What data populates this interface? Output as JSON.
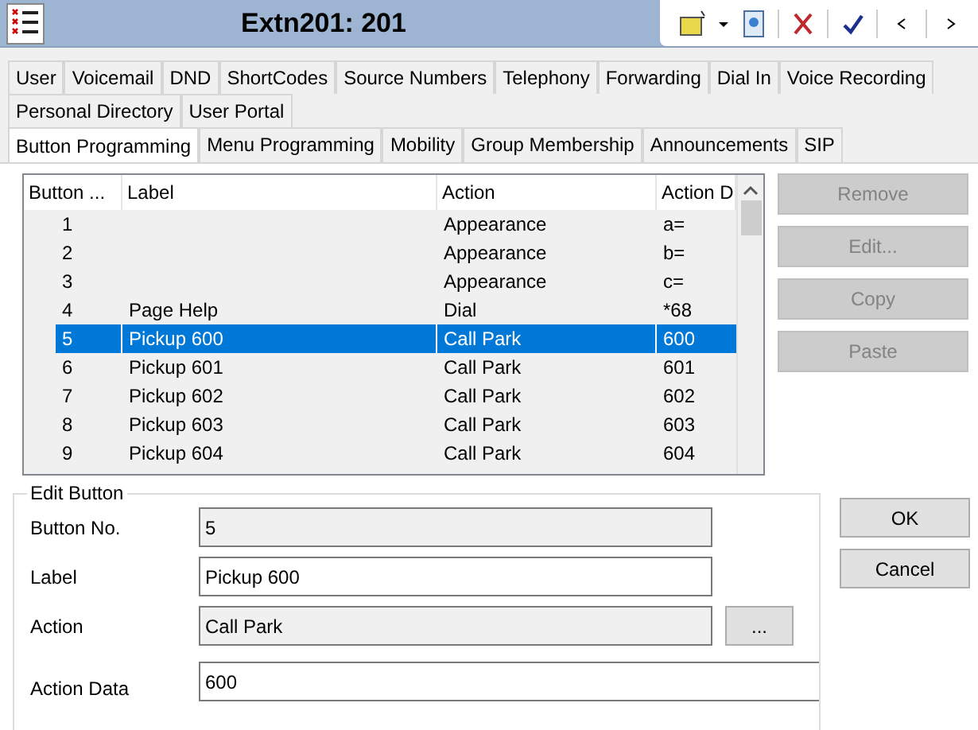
{
  "window": {
    "title": "Extn201: 201"
  },
  "tab_rows": [
    [
      {
        "label": "User",
        "selected": false
      },
      {
        "label": "Voicemail",
        "selected": false
      },
      {
        "label": "DND",
        "selected": false
      },
      {
        "label": "ShortCodes",
        "selected": false
      },
      {
        "label": "Source Numbers",
        "selected": false
      },
      {
        "label": "Telephony",
        "selected": false
      },
      {
        "label": "Forwarding",
        "selected": false
      },
      {
        "label": "Dial In",
        "selected": false
      },
      {
        "label": "Voice Recording",
        "selected": false
      }
    ],
    [
      {
        "label": "Personal Directory",
        "selected": false
      },
      {
        "label": "User Portal",
        "selected": false
      }
    ],
    [
      {
        "label": "Button Programming",
        "selected": true
      },
      {
        "label": "Menu Programming",
        "selected": false
      },
      {
        "label": "Mobility",
        "selected": false
      },
      {
        "label": "Group Membership",
        "selected": false
      },
      {
        "label": "Announcements",
        "selected": false
      },
      {
        "label": "SIP",
        "selected": false
      }
    ]
  ],
  "table": {
    "columns": [
      "Button ...",
      "Label",
      "Action",
      "Action D"
    ],
    "rows": [
      {
        "cells": [
          "1",
          "",
          "Appearance",
          "a="
        ],
        "selected": false
      },
      {
        "cells": [
          "2",
          "",
          "Appearance",
          "b="
        ],
        "selected": false
      },
      {
        "cells": [
          "3",
          "",
          "Appearance",
          "c="
        ],
        "selected": false
      },
      {
        "cells": [
          "4",
          "Page Help",
          "Dial",
          "*68"
        ],
        "selected": false
      },
      {
        "cells": [
          "5",
          "Pickup 600",
          "Call Park",
          "600"
        ],
        "selected": true
      },
      {
        "cells": [
          "6",
          "Pickup 601",
          "Call Park",
          "601"
        ],
        "selected": false
      },
      {
        "cells": [
          "7",
          "Pickup 602",
          "Call Park",
          "602"
        ],
        "selected": false
      },
      {
        "cells": [
          "8",
          "Pickup 603",
          "Call Park",
          "603"
        ],
        "selected": false
      },
      {
        "cells": [
          "9",
          "Pickup 604",
          "Call Park",
          "604"
        ],
        "selected": false
      }
    ]
  },
  "list_buttons": [
    {
      "label": "Remove",
      "disabled": true
    },
    {
      "label": "Edit...",
      "disabled": true
    },
    {
      "label": "Copy",
      "disabled": true
    },
    {
      "label": "Paste",
      "disabled": true
    }
  ],
  "edit_button": {
    "title": "Edit Button",
    "fields": [
      {
        "label": "Button No.",
        "value": "5",
        "readonly": true
      },
      {
        "label": "Label",
        "value": "Pickup 600",
        "readonly": false
      },
      {
        "label": "Action",
        "value": "Call Park",
        "readonly": true,
        "browse": "..."
      },
      {
        "label": "Action Data",
        "value": "600",
        "readonly": false
      }
    ]
  },
  "dialog_buttons": [
    "OK",
    "Cancel"
  ]
}
